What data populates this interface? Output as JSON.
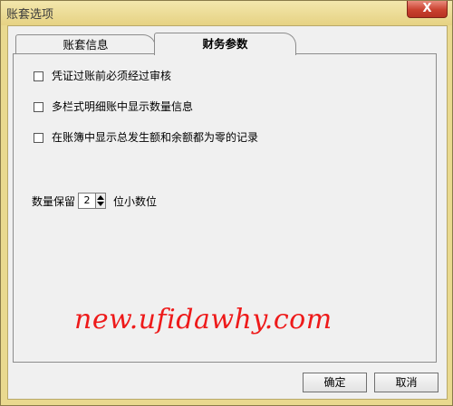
{
  "window": {
    "title": "账套选项",
    "close_label": "X"
  },
  "tabs": [
    {
      "label": "账套信息",
      "selected": false
    },
    {
      "label": "财务参数",
      "selected": true
    }
  ],
  "options": [
    {
      "label": "凭证过账前必须经过审核",
      "checked": false
    },
    {
      "label": "多栏式明细账中显示数量信息",
      "checked": false
    },
    {
      "label": "在账簿中显示总发生额和余额都为零的记录",
      "checked": false
    }
  ],
  "quantity": {
    "prefix": "数量保留",
    "value": "2",
    "suffix": "位小数位"
  },
  "watermark": "new.ufidawhy.com",
  "buttons": {
    "ok": "确定",
    "cancel": "取消"
  },
  "colors": {
    "title_bar": "#e9d98f",
    "close_button": "#c9412f",
    "watermark": "#ee1a1a"
  }
}
